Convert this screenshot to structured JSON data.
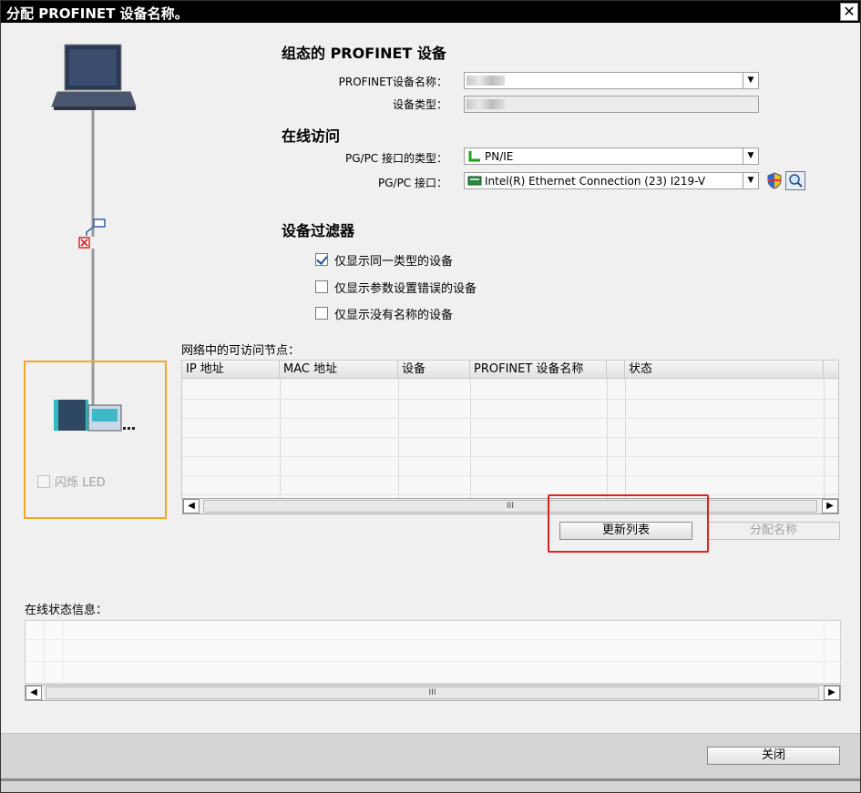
{
  "window": {
    "title": "分配 PROFINET 设备名称。",
    "close_symbol": "✕"
  },
  "configured": {
    "section_title": "组态的 PROFINET 设备",
    "name_label": "PROFINET设备名称：",
    "type_label": "设备类型："
  },
  "online": {
    "section_title": "在线访问",
    "iface_type_label": "PG/PC 接口的类型：",
    "iface_type_value": "PN/IE",
    "iface_label": "PG/PC 接口：",
    "iface_value": "Intel(R) Ethernet Connection (23) I219-V"
  },
  "filter": {
    "section_title": "设备过滤器",
    "options": [
      {
        "label": "仅显示同一类型的设备",
        "checked": true
      },
      {
        "label": "仅显示参数设置错误的设备",
        "checked": false
      },
      {
        "label": "仅显示没有名称的设备",
        "checked": false
      }
    ]
  },
  "nodes": {
    "label": "网络中的可访问节点：",
    "columns": [
      "IP 地址",
      "MAC 地址",
      "设备",
      "PROFINET 设备名称",
      "状态"
    ],
    "rows": []
  },
  "scroll_thumb": "III",
  "buttons": {
    "update_list": "更新列表",
    "assign_name": "分配名称",
    "close": "关闭"
  },
  "flash": {
    "label": "闪烁 LED",
    "checked": false
  },
  "status_info": {
    "label": "在线状态信息："
  },
  "dropdown_arrow": "▼",
  "scroll_left": "◀",
  "scroll_right": "▶",
  "colors": {
    "highlight": "#e0211f",
    "orange_box": "#f5a623",
    "check": "#1e4f9c"
  }
}
